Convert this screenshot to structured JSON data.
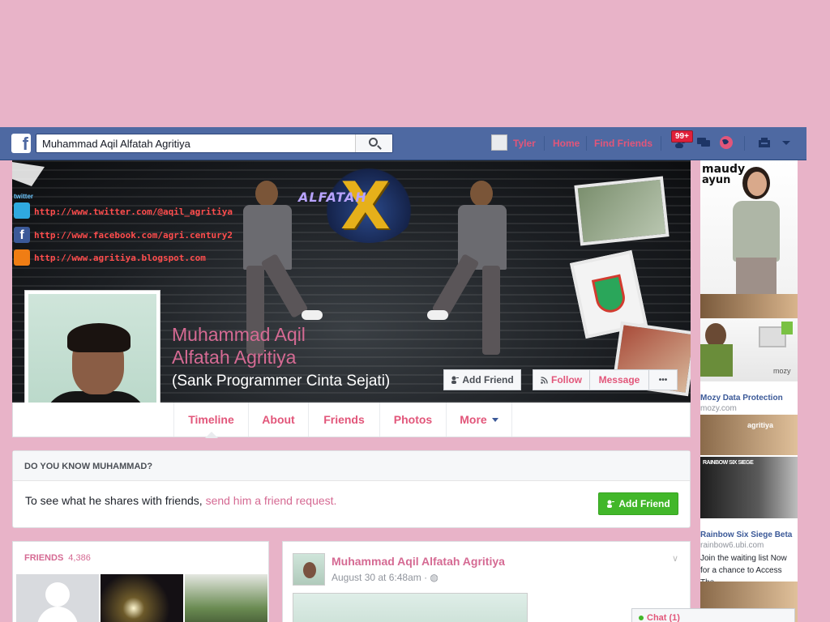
{
  "topbar": {
    "logo": "f",
    "search_value": "Muhammad Aqil Alfatah Agritiya",
    "user_name": "Tyler",
    "home": "Home",
    "find_friends": "Find Friends",
    "notifications_badge": "99+"
  },
  "cover": {
    "social_label": "twitter",
    "links": [
      "http://www.twitter.com/@aqil_agritiya",
      "http://www.facebook.com/agri.century2",
      "http://www.agritiya.blogspot.com"
    ],
    "logo_text": "ALFATAH",
    "logo_letter": "X"
  },
  "profile": {
    "name_line1": "Muhammad Aqil",
    "name_line2": "Alfatah Agritiya",
    "nickname": "(Sank Programmer Cinta Sejati)",
    "add_friend": "Add Friend",
    "follow": "Follow",
    "message": "Message",
    "more_dots": "•••"
  },
  "tabs": [
    "Timeline",
    "About",
    "Friends",
    "Photos",
    "More"
  ],
  "know_box": {
    "heading": "DO YOU KNOW MUHAMMAD?",
    "text": "To see what he shares with friends, ",
    "link": "send him a friend request.",
    "button": "Add Friend"
  },
  "friends": {
    "title": "FRIENDS",
    "count": "4,386"
  },
  "post": {
    "author": "Muhammad Aqil Alfatah Agritiya",
    "time": "August 30 at 6:48am · "
  },
  "ads": {
    "brand1": "maudy",
    "brand1b": "ayun",
    "ad2_title": "Mozy Data Protection",
    "ad2_domain": "mozy.com",
    "ad2_logo": "mozy",
    "ad3_brand": "agritiya",
    "ad3_title": "Rainbow Six Siege Beta",
    "ad3_domain": "rainbow6.ubi.com",
    "ad3_desc": "Join the waiting list Now for a chance to Access The",
    "ad3_game": "RAINBOW SIX SIEGE"
  },
  "chat": {
    "label": "Chat (1)"
  },
  "colors": {
    "page_bg": "#e8b3c8",
    "topbar": "#4e69a2",
    "link_pink": "#e2567a",
    "name_pink": "#d56a93",
    "green_btn": "#42b72a"
  }
}
